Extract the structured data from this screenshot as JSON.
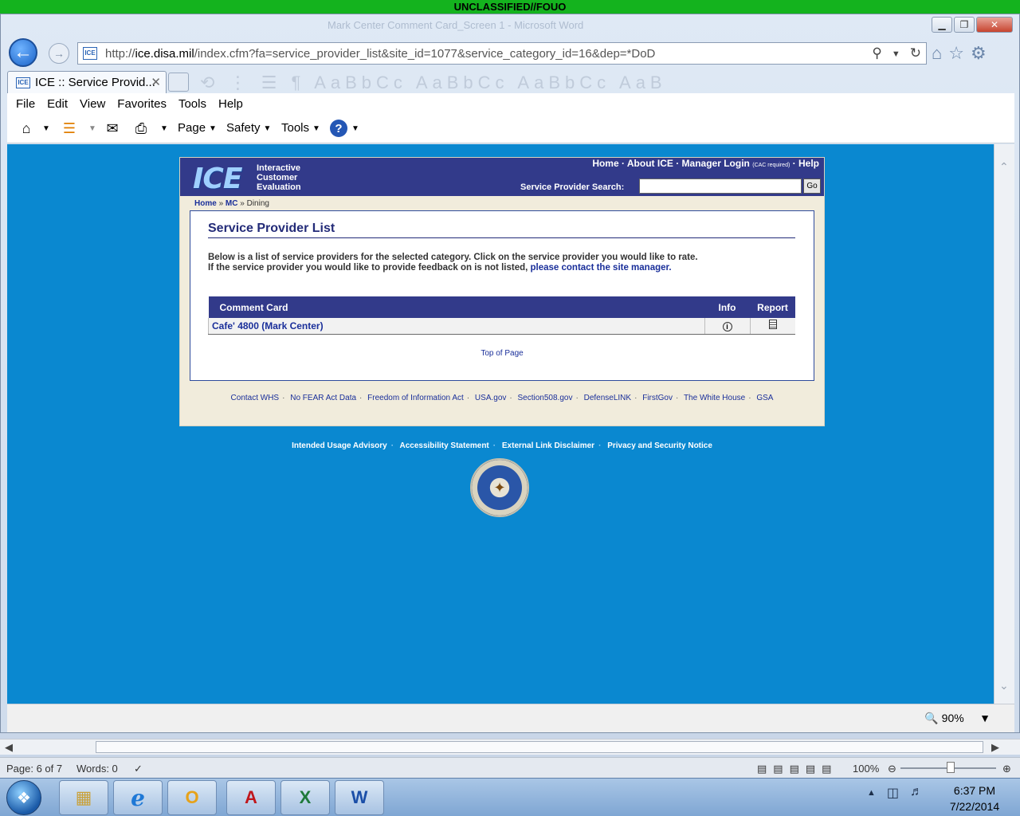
{
  "banner": "UNCLASSIFIED//FOUO",
  "ghost_title": "Mark Center Comment Card_Screen 1 - Microsoft Word",
  "address": {
    "prefix": "http://",
    "domain": "ice.disa.mil",
    "path": "/index.cfm?fa=service_provider_list&site_id=1077&service_category_id=16&dep=*DoD"
  },
  "tab": {
    "icon_text": "ICE",
    "title": "ICE :: Service Provid..."
  },
  "menu": [
    "File",
    "Edit",
    "View",
    "Favorites",
    "Tools",
    "Help"
  ],
  "commands": {
    "page": "Page",
    "safety": "Safety",
    "tools": "Tools"
  },
  "ice": {
    "logo": "ICE",
    "tagline": [
      "Interactive",
      "Customer",
      "Evaluation"
    ],
    "topnav": {
      "home": "Home",
      "about": "About ICE",
      "manager": "Manager Login",
      "cac": "(CAC required)",
      "help": "Help"
    },
    "search_label": "Service Provider Search:",
    "search_value": "",
    "go": "Go",
    "breadcrumb": {
      "home": "Home",
      "mc": "MC",
      "current": "Dining",
      "sep": "»"
    },
    "panel_title": "Service Provider List",
    "intro_line1": "Below is a list of service providers for the selected category. Click on the service provider you would like to rate.",
    "intro_line2": "If the service provider you would like to provide feedback on is not listed,",
    "intro_link": "please contact the site manager.",
    "table": {
      "headers": [
        "Comment Card",
        "Info",
        "Report"
      ],
      "rows": [
        {
          "name": "Cafe' 4800 (Mark Center)"
        }
      ]
    },
    "top_of_page": "Top of Page",
    "footer_links": [
      "Contact WHS",
      "No FEAR Act Data",
      "Freedom of Information Act",
      "USA.gov",
      "Section508.gov",
      "DefenseLINK",
      "FirstGov",
      "The White House",
      "GSA"
    ],
    "lower_links": [
      "Intended Usage Advisory",
      "Accessibility Statement",
      "External Link Disclaimer",
      "Privacy and Security Notice"
    ]
  },
  "ie_status": {
    "zoom": "90%"
  },
  "word_status": {
    "page": "Page: 6 of 7",
    "words": "Words: 0",
    "zoom": "100%"
  },
  "clock": {
    "time": "6:37 PM",
    "date": "7/22/2014"
  },
  "taskbar_apps": [
    {
      "name": "explorer",
      "glyph": "📁"
    },
    {
      "name": "internet-explorer",
      "glyph": "e"
    },
    {
      "name": "outlook",
      "glyph": "O"
    },
    {
      "name": "acrobat",
      "glyph": "A"
    },
    {
      "name": "excel",
      "glyph": "X"
    },
    {
      "name": "word",
      "glyph": "W"
    }
  ]
}
